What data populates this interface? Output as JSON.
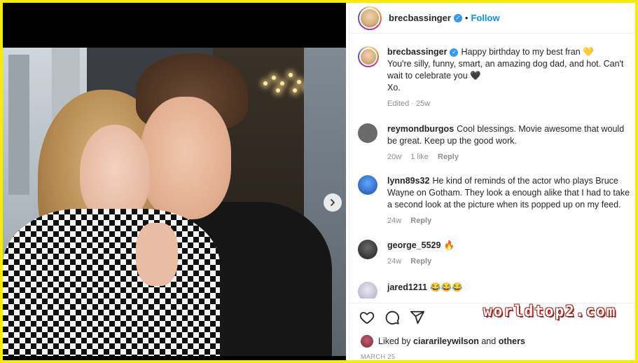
{
  "post": {
    "username": "brecbassinger",
    "follow_label": "Follow",
    "dot": "•",
    "caption_lines": [
      "Happy birthday to my best fran 💛",
      "You're silly, funny, smart, an amazing dog dad, and hot. Can't",
      "wait to celebrate you 🖤",
      "Xo."
    ],
    "caption_meta": "Edited · 25w"
  },
  "comments": [
    {
      "user": "reymondburgos",
      "text": "Cool blessings. Movie awesome that would be great. Keep up the good work.",
      "time": "20w",
      "likes": "1 like",
      "reply": "Reply",
      "avatar_color": "#6a6a6a"
    },
    {
      "user": "lynn89s32",
      "text": "He kind of reminds of the actor who plays Bruce Wayne on Gotham. They look a enough alike that I had to take a second look at the picture when its popped up on my feed.",
      "time": "24w",
      "likes": "",
      "reply": "Reply",
      "avatar_color": "#2b6fd6"
    },
    {
      "user": "george_5529",
      "text": "🔥",
      "time": "24w",
      "likes": "",
      "reply": "Reply",
      "avatar_color": "#3c3c3c"
    },
    {
      "user": "jared1211",
      "text": "😂😂😂",
      "time": "",
      "likes": "",
      "reply": "",
      "avatar_color": "#c9c9d8"
    }
  ],
  "footer": {
    "liked_prefix": "Liked by",
    "liked_user": "ciararileywilson",
    "liked_and": "and",
    "liked_others": "others",
    "date": "MARCH 25"
  },
  "watermark": "worldtop2.com",
  "colors": {
    "accent": "#0095f6",
    "verified": "#3897f0",
    "frame": "#f5ec00"
  },
  "icons": [
    "heart-icon",
    "comment-icon",
    "share-icon",
    "chevron-right-icon",
    "verified-icon"
  ]
}
